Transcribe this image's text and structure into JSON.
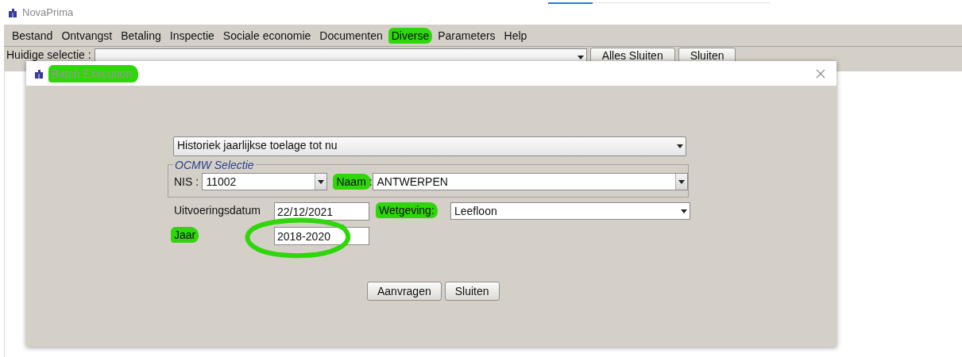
{
  "app": {
    "title": "NovaPrima"
  },
  "loading_bar": {
    "level": 0.2
  },
  "menu": [
    {
      "label": "Bestand",
      "highlighted": false
    },
    {
      "label": "Ontvangst",
      "highlighted": false
    },
    {
      "label": "Betaling",
      "highlighted": false
    },
    {
      "label": "Inspectie",
      "highlighted": false
    },
    {
      "label": "Sociale economie",
      "highlighted": false
    },
    {
      "label": "Documenten",
      "highlighted": false
    },
    {
      "label": "Diverse",
      "highlighted": true
    },
    {
      "label": "Parameters",
      "highlighted": false
    },
    {
      "label": "Help",
      "highlighted": false
    }
  ],
  "toolbar": {
    "label": "Huidige selectie :",
    "buttons": [
      "Alles Sluiten",
      "Sluiten"
    ]
  },
  "dialog": {
    "title": "Batch Execution",
    "title_highlighted": true,
    "report": {
      "value": "Historiek jaarlijkse toelage tot nu"
    },
    "ocmw": {
      "legend": "OCMW Selectie",
      "nis": {
        "label": "NIS :",
        "value": "11002",
        "highlighted": false
      },
      "naam": {
        "label": "Naam :",
        "value": "ANTWERPEN",
        "highlighted": true
      }
    },
    "rows": [
      {
        "fields": [
          {
            "kind": "text",
            "label": "Uitvoeringsdatum",
            "value": "22/12/2021",
            "highlighted": false,
            "circled": false
          },
          {
            "kind": "combo",
            "label": "Wetgeving:",
            "value": "Leefloon",
            "highlighted": true,
            "circled": false
          }
        ]
      },
      {
        "fields": [
          {
            "kind": "text",
            "label": "Jaar",
            "value": "2018-2020",
            "highlighted": true,
            "circled": true
          }
        ]
      }
    ],
    "buttons": [
      "Aanvragen",
      "Sluiten"
    ]
  }
}
